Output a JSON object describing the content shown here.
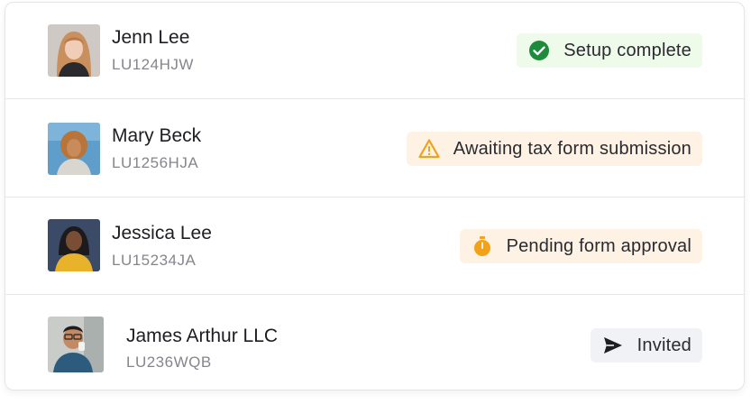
{
  "users": [
    {
      "name": "Jenn Lee",
      "code": "LU124HJW",
      "status": "Setup complete",
      "status_icon": "check-circle-icon",
      "status_color": "#1e8a3c"
    },
    {
      "name": "Mary Beck",
      "code": "LU1256HJA",
      "status": "Awaiting tax form submission",
      "status_icon": "warning-triangle-icon",
      "status_color": "#f2a21a"
    },
    {
      "name": "Jessica Lee",
      "code": "LU15234JA",
      "status": "Pending form approval",
      "status_icon": "stopwatch-icon",
      "status_color": "#f2a21a"
    },
    {
      "name": "James Arthur LLC",
      "code": "LU236WQB",
      "status": "Invited",
      "status_icon": "send-icon",
      "status_color": "#1d1d22"
    }
  ]
}
